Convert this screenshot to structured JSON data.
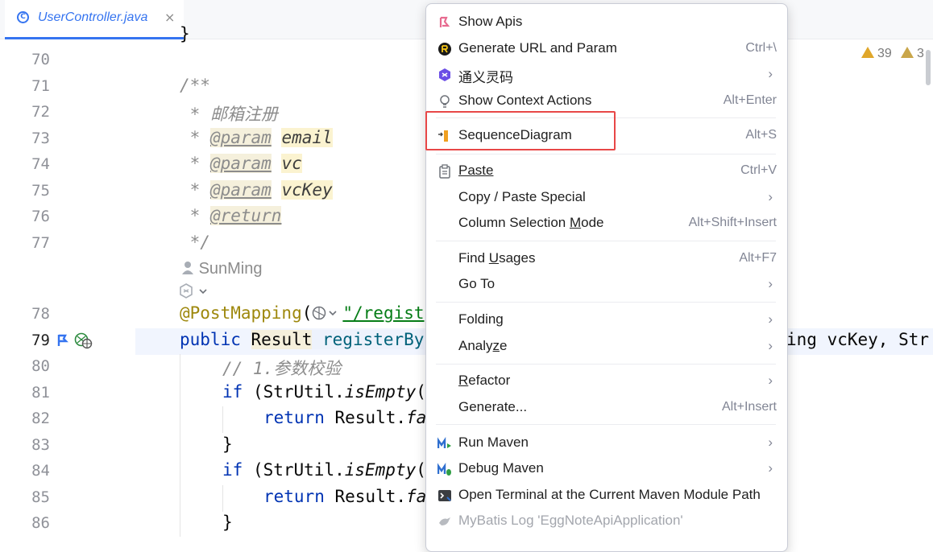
{
  "tab": {
    "name": "UserController.java",
    "close": "×",
    "icon": "C"
  },
  "warnings": {
    "count1": "39",
    "count2": "3"
  },
  "author": "SunMing",
  "lines": {
    "l70": "70",
    "l71": "71",
    "l72": "72",
    "l73": "73",
    "l74": "74",
    "l75": "75",
    "l76": "76",
    "l77": "77",
    "l78": "78",
    "l79": "79",
    "l80": "80",
    "l81": "81",
    "l82": "82",
    "l83": "83",
    "l84": "84",
    "l85": "85",
    "l86": "86"
  },
  "code": {
    "c69": "}",
    "c71": "/**",
    "c72_star": " * ",
    "c72": "邮箱注册",
    "c73_star": " * ",
    "c73_tag": "@param",
    "c73_name": "email",
    "c74_star": " * ",
    "c74_tag": "@param",
    "c74_name": "vc",
    "c75_star": " * ",
    "c75_tag": "@param",
    "c75_name": "vcKey",
    "c76_star": " * ",
    "c76_tag": "@return",
    "c77": " */",
    "c78_ann": "@PostMapping",
    "c78_p": "(",
    "c78_str": "\"/regist",
    "c79_kw": "public ",
    "c79_type": "Result",
    "c79_name": " registerBy",
    "c79_tail": "ing vcKey, Str",
    "c80": "// 1.参数校验",
    "c81_kw": "if",
    "c81_a": " (StrUtil.",
    "c81_m": "isEmpty",
    "c81_b": "(",
    "c82_kw": "return",
    "c82_a": " Result.",
    "c82_m": "fa",
    "c83": "}",
    "c84_kw": "if",
    "c84_a": " (StrUtil.",
    "c84_m": "isEmpty",
    "c84_b": "(",
    "c85_kw": "return",
    "c85_a": " Result.",
    "c85_m": "fa",
    "c86": "}"
  },
  "menu": {
    "show_apis": "Show Apis",
    "gen_url": "Generate URL and Param",
    "gen_url_sc": "Ctrl+\\",
    "tongyi": "通义灵码",
    "show_ctx": "Show Context Actions",
    "show_ctx_sc": "Alt+Enter",
    "seq": "SequenceDiagram",
    "seq_sc": "Alt+S",
    "paste": "Paste",
    "paste_sc": "Ctrl+V",
    "copy_paste": "Copy / Paste Special",
    "col_sel_a": "Column Selection ",
    "col_sel_u": "M",
    "col_sel_b": "ode",
    "col_sel_sc": "Alt+Shift+Insert",
    "find_a": "Find ",
    "find_u": "U",
    "find_b": "sages",
    "find_sc": "Alt+F7",
    "goto": "Go To",
    "folding": "Folding",
    "analyze_a": "Analy",
    "analyze_u": "z",
    "analyze_b": "e",
    "refactor_u": "R",
    "refactor_b": "efactor",
    "generate": "Generate...",
    "generate_sc": "Alt+Insert",
    "run_maven": "Run Maven",
    "debug_maven": "Debug Maven",
    "open_term": "Open Terminal at the Current Maven Module Path",
    "mybatis": "MyBatis Log 'EggNoteApiApplication'",
    "submenu_arrow": "›"
  }
}
